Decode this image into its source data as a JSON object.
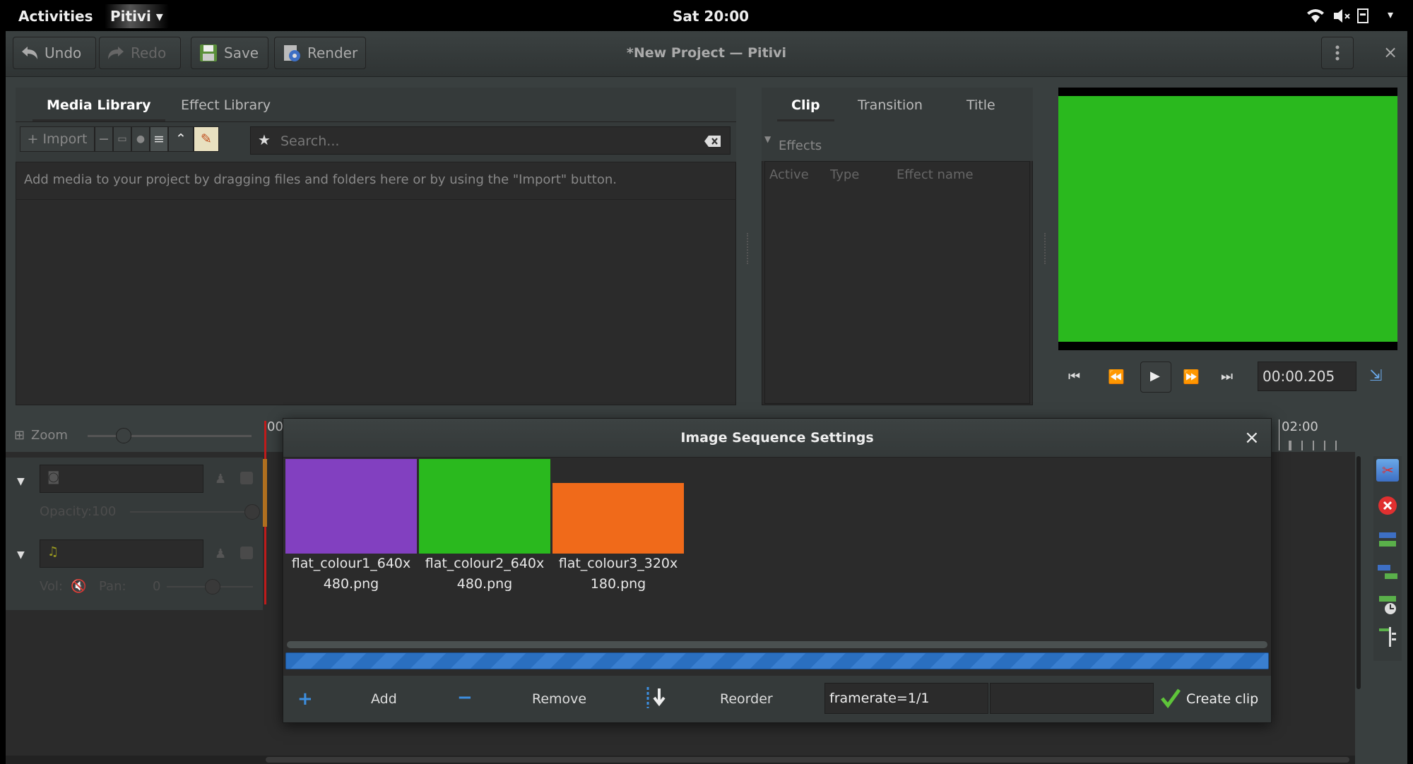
{
  "topbar": {
    "activities": "Activities",
    "app_menu": "Pitivi ▾",
    "clock": "Sat 20:00",
    "system_menu_arrow": "▾"
  },
  "header": {
    "title": "*New Project — Pitivi",
    "undo": "Undo",
    "redo": "Redo",
    "save": "Save",
    "render": "Render",
    "close": "×"
  },
  "library": {
    "tabs": [
      "Media Library",
      "Effect Library"
    ],
    "import_label": "+ Import",
    "search_placeholder": "Search...",
    "hint": "Add media to your project by dragging files and folders here or by using the \"Import\" button."
  },
  "clip_panel": {
    "tabs": [
      "Clip",
      "Transition",
      "Title"
    ],
    "effects_label": "Effects",
    "columns": [
      "Active",
      "Type",
      "Effect name"
    ]
  },
  "viewer": {
    "timecode": "00:00.205",
    "preview_color": "#2ab91e"
  },
  "timeline": {
    "zoom_label": "Zoom",
    "ruler_start": "00",
    "ruler_end": "02:00",
    "layer1_opacity": "Opacity:100",
    "layer2_vol": "Vol:",
    "layer2_pan": "Pan:",
    "layer2_pan_value": "0"
  },
  "dialog": {
    "title": "Image Sequence Settings",
    "close": "×",
    "images": [
      {
        "line1": "flat_colour1_640x",
        "line2": "480.png",
        "color": "#8240c0"
      },
      {
        "line1": "flat_colour2_640x",
        "line2": "480.png",
        "color": "#2ab91e"
      },
      {
        "line1": "flat_colour3_320x",
        "line2": "180.png",
        "color": "#f06a1a"
      }
    ],
    "add_label": "Add",
    "remove_label": "Remove",
    "reorder_label": "Reorder",
    "framerate_value": "framerate=1/1",
    "create_label": "Create clip"
  }
}
